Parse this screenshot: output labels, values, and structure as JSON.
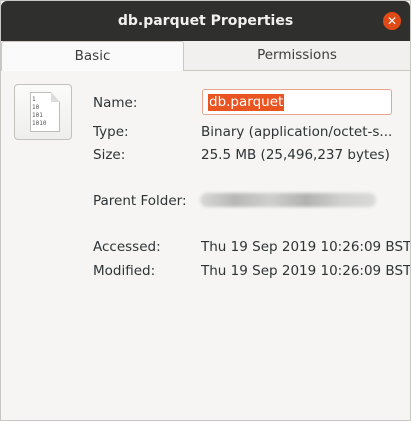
{
  "window": {
    "title": "db.parquet Properties",
    "close_glyph": "✕"
  },
  "tabs": [
    {
      "label": "Basic",
      "active": true
    },
    {
      "label": "Permissions",
      "active": false
    }
  ],
  "file": {
    "icon": "binary-file-icon",
    "icon_bits": "1\n10\n101\n1010"
  },
  "properties": {
    "name_label": "Name:",
    "name_value": "db.parquet",
    "type_label": "Type:",
    "type_value": "Binary (application/octet-s...",
    "size_label": "Size:",
    "size_value": "25.5 MB (25,496,237 bytes)",
    "parent_label": "Parent Folder:",
    "accessed_label": "Accessed:",
    "accessed_value": "Thu 19 Sep 2019 10:26:09 BST",
    "modified_label": "Modified:",
    "modified_value": "Thu 19 Sep 2019 10:26:09 BST"
  },
  "colors": {
    "titlebar": "#2f2f2d",
    "close_button": "#df4a16",
    "selection": "#e95420",
    "window_bg": "#f6f5f4"
  }
}
